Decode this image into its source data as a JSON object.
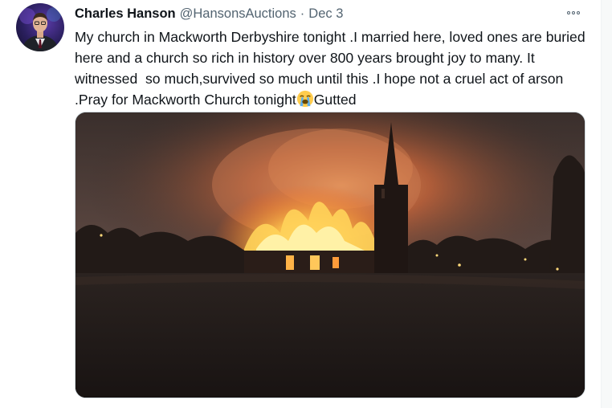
{
  "tweet": {
    "author_name": "Charles Hanson",
    "handle": "@HansonsAuctions",
    "separator": "·",
    "date": "Dec 3",
    "text_main": "My church in Mackworth Derbyshire tonight .I married here, loved ones are buried here and a church so rich in history over 800 years brought joy to many. It witnessed  so much,survived so much until this .I hope not a cruel act of arson .Pray for Mackworth Church tonight",
    "text_tail": "Gutted",
    "emoji": "loudly-crying-face-icon"
  },
  "icons": {
    "more": "more-options-icon",
    "avatar": "avatar"
  },
  "colors": {
    "text": "#0f1419",
    "secondary": "#536471",
    "border": "#cfd9de",
    "fire": "#ff9a3c"
  }
}
